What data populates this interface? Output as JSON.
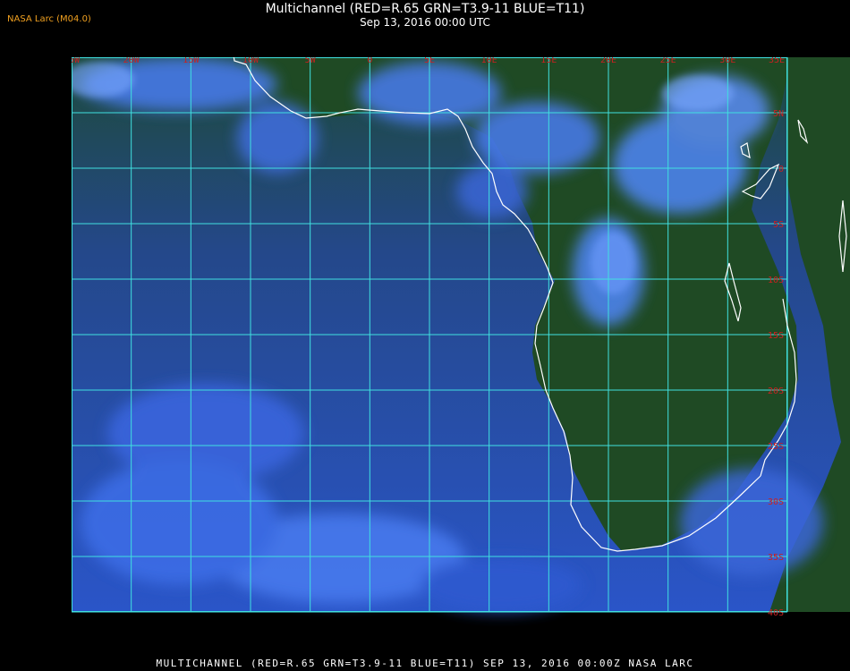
{
  "header": {
    "credit": "NASA Larc (M04.0)",
    "title": "Multichannel (RED=R.65 GRN=T3.9-11 BLUE=T11)",
    "subtitle": "Sep 13, 2016 00:00 UTC"
  },
  "footer": {
    "caption": "MULTICHANNEL (RED=R.65 GRN=T3.9-11 BLUE=T11) SEP 13, 2016 00:00Z  NASA LARC"
  },
  "map": {
    "lon_labels": [
      "25W",
      "20W",
      "15W",
      "10W",
      "5W",
      "0",
      "5E",
      "10E",
      "15E",
      "20E",
      "25E",
      "30E",
      "35E"
    ],
    "lat_labels": [
      "5N",
      "0",
      "5S",
      "10S",
      "15S",
      "20S",
      "25S",
      "30S",
      "35S",
      "40S"
    ],
    "colors": {
      "grid": "#40e0e0",
      "label": "#cc2020",
      "coast": "#ffffff",
      "land": "#1f4a24",
      "ocean": "#2448a8",
      "cloud": "#4a7cf0"
    }
  }
}
